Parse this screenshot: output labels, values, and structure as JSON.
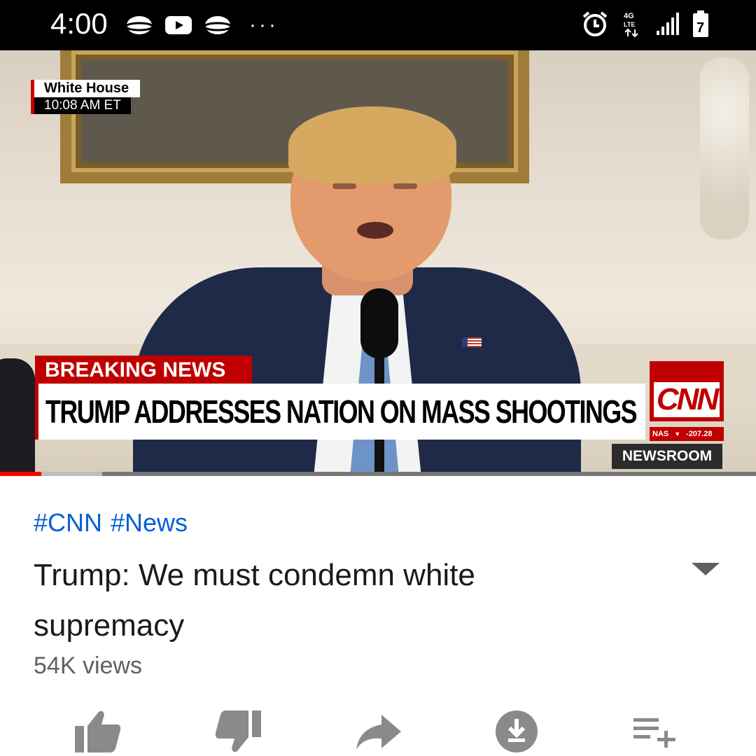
{
  "status_bar": {
    "time": "4:00",
    "notification_icons": [
      "sphere-icon",
      "youtube-icon",
      "sphere-icon"
    ],
    "more": "···",
    "network": "4G LTE",
    "battery_level": "7"
  },
  "video": {
    "location": "White House",
    "time_label": "10:08 AM ET",
    "breaking": "BREAKING NEWS",
    "headline": "TRUMP ADDRESSES NATION ON MASS SHOOTINGS",
    "network_logo": "CNN",
    "ticker_symbol": "NAS",
    "ticker_value": "-207.28",
    "show": "NEWSROOM",
    "progress_played": 0.055,
    "progress_buffered": 0.135
  },
  "info": {
    "hashtags": [
      "#CNN",
      "#News"
    ],
    "title": "Trump: We must condemn white supremacy",
    "views": "54K views"
  },
  "actions": [
    "like-icon",
    "dislike-icon",
    "share-icon",
    "download-icon",
    "add-to-playlist-icon"
  ],
  "colors": {
    "accent_red": "#c00000",
    "progress_red": "#ff0000",
    "link_blue": "#065fd4",
    "icon_gray": "#8a8a8a"
  }
}
